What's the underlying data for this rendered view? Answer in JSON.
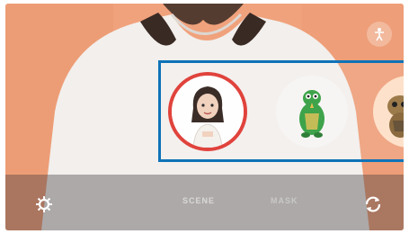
{
  "colors": {
    "background": "#f0a27c",
    "shirt": "#f2efec",
    "hair": "#3a2a24",
    "selection_frame": "#0f73b8",
    "selected_ring": "#e0433c"
  },
  "top_bar": {
    "icon": "body-icon"
  },
  "sticker_strip": {
    "items": [
      {
        "name": "my-emoji-avatar",
        "selected": true
      },
      {
        "name": "green-dinosaur-sticker",
        "selected": false
      },
      {
        "name": "brown-creature-sticker",
        "selected": false
      }
    ]
  },
  "bottom_bar": {
    "left_icon": "settings-icon",
    "modes": [
      "SCENE",
      "MASK"
    ],
    "right_icon": "switch-camera-icon"
  }
}
